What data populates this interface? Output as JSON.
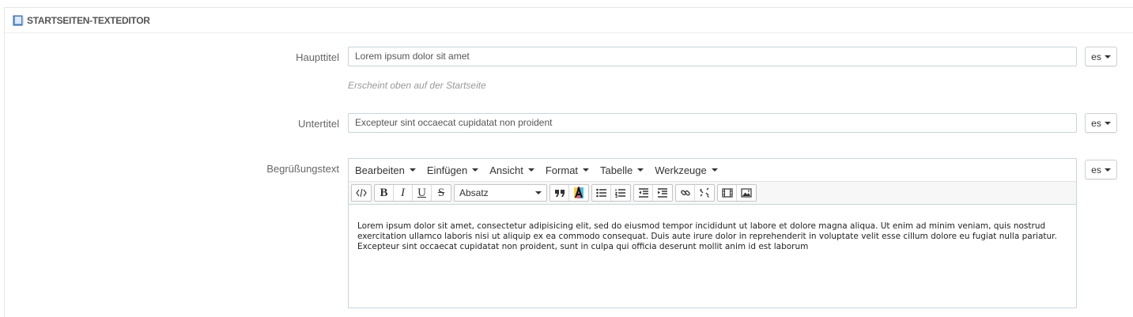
{
  "panel": {
    "title": "STARTSEITEN-TEXTEDITOR",
    "icon": "book-icon"
  },
  "fields": {
    "main_title": {
      "label": "Haupttitel",
      "value": "Lorem ipsum dolor sit amet",
      "help": "Erscheint oben auf der Startseite",
      "lang": "es"
    },
    "subtitle": {
      "label": "Untertitel",
      "value": "Excepteur sint occaecat cupidatat non proident",
      "lang": "es"
    },
    "welcome": {
      "label": "Begrüßungstext",
      "lang": "es"
    }
  },
  "editor": {
    "menu": [
      "Bearbeiten",
      "Einfügen",
      "Ansicht",
      "Format",
      "Tabelle",
      "Werkzeuge"
    ],
    "format_select": "Absatz",
    "content": "Lorem ipsum dolor sit amet, consectetur adipisicing elit, sed do eiusmod tempor incididunt ut labore et dolore magna aliqua. Ut enim ad minim veniam, quis nostrud exercitation ullamco laboris nisi ut aliquip ex ea commodo consequat. Duis aute irure dolor in reprehenderit in voluptate velit esse cillum dolore eu fugiat nulla pariatur. Excepteur sint occaecat cupidatat non proident, sunt in culpa qui officia deserunt mollit anim id est laborum"
  },
  "colors": {
    "input_border": "#c7d6db",
    "help_text": "#999999",
    "label_text": "#666666"
  }
}
